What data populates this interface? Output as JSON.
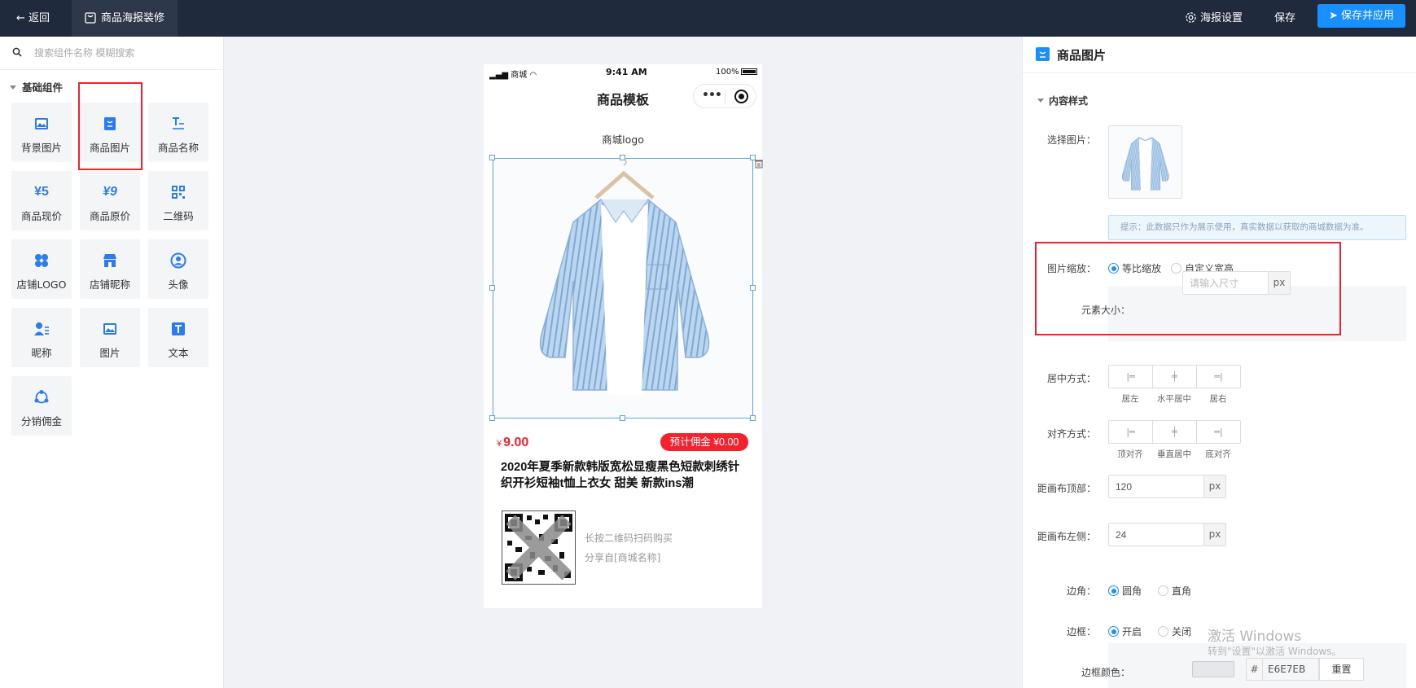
{
  "topbar": {
    "back_label": "返回",
    "tab_label": "商品海报装修",
    "poster_settings_label": "海报设置",
    "save_label": "保存",
    "save_apply_label": "保存并应用"
  },
  "left_panel": {
    "search_placeholder": "搜索组件名称 模糊搜索",
    "group_title": "基础组件",
    "components": [
      {
        "label": "背景图片",
        "icon": "background-image-icon"
      },
      {
        "label": "商品图片",
        "icon": "product-image-icon"
      },
      {
        "label": "商品名称",
        "icon": "product-name-icon"
      },
      {
        "label": "商品现价",
        "icon": "current-price-icon",
        "glyph": "¥5"
      },
      {
        "label": "商品原价",
        "icon": "original-price-icon",
        "glyph": "¥9"
      },
      {
        "label": "二维码",
        "icon": "qrcode-icon"
      },
      {
        "label": "店铺LOGO",
        "icon": "store-logo-icon"
      },
      {
        "label": "店铺昵称",
        "icon": "store-icon"
      },
      {
        "label": "头像",
        "icon": "avatar-icon"
      },
      {
        "label": "昵称",
        "icon": "nickname-icon"
      },
      {
        "label": "图片",
        "icon": "image-icon"
      },
      {
        "label": "文本",
        "icon": "text-icon"
      },
      {
        "label": "分销佣金",
        "icon": "commission-icon"
      }
    ]
  },
  "phone": {
    "status_left": "商城",
    "status_time": "9:41 AM",
    "status_battery": "100%",
    "title": "商品模板",
    "store_logo": "商城logo",
    "price_symbol": "¥",
    "price": "9.00",
    "commission": "预计佣金 ¥0.00",
    "product_name": "2020年夏季新款韩版宽松显瘦黑色短款刺绣针织开衫短袖t恤上衣女 甜美 新款ins潮",
    "qr_hint": "长按二维码扫码购买",
    "share_from": "分享自[商城名称]"
  },
  "right_panel": {
    "title": "商品图片",
    "section": "内容样式",
    "select_image_label": "选择图片：",
    "tip": "提示：此数据只作为展示使用，真实数据以获取的商城数据为准。",
    "scale_label": "图片缩放：",
    "scale_options": [
      "等比缩放",
      "自定义宽高"
    ],
    "scale_selected": "等比缩放",
    "size_label": "元素大小：",
    "size_placeholder": "请输入尺寸",
    "unit": "px",
    "center_label": "居中方式：",
    "center_options": [
      "居左",
      "水平居中",
      "居右"
    ],
    "align_label": "对齐方式：",
    "align_options": [
      "顶对齐",
      "垂直居中",
      "底对齐"
    ],
    "top_label": "距画布顶部：",
    "top_value": "120",
    "left_label": "距画布左侧：",
    "left_value": "24",
    "corner_label": "边角：",
    "corner_options": [
      "圆角",
      "直角"
    ],
    "corner_selected": "圆角",
    "border_label": "边框：",
    "border_options": [
      "开启",
      "关闭"
    ],
    "border_selected": "开启",
    "border_color_label": "边框颜色：",
    "border_color_hash": "#",
    "border_color_hex": "E6E7EB",
    "reset_label": "重置"
  },
  "watermark": {
    "line1": "激活 Windows",
    "line2": "转到\"设置\"以激活 Windows。"
  },
  "colors": {
    "topbar_bg": "#1f2a3d",
    "primary": "#1890ff",
    "danger": "#f5222d",
    "border_color_swatch": "#e6e7eb"
  }
}
